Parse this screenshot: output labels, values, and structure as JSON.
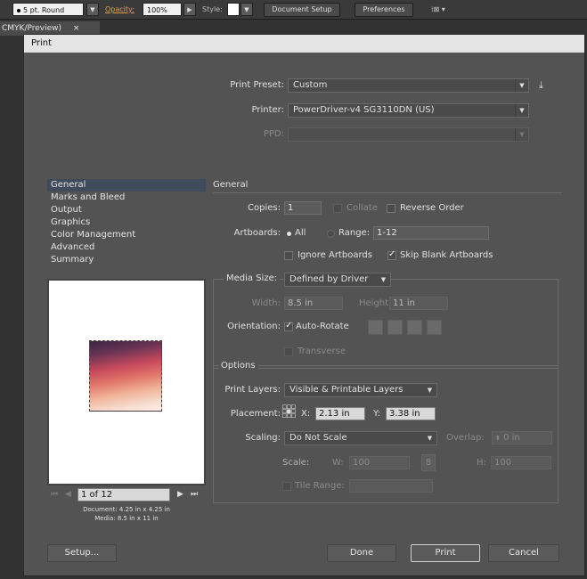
{
  "toolbar": {
    "brush": "5 pt. Round",
    "opacity_label": "Opacity:",
    "opacity_value": "100%",
    "style_label": "Style:",
    "document_setup": "Document Setup",
    "preferences": "Preferences"
  },
  "doc_tab": {
    "title": "CMYK/Preview)",
    "close": "×"
  },
  "dialog": {
    "title": "Print",
    "print_preset_label": "Print Preset:",
    "print_preset_value": "Custom",
    "printer_label": "Printer:",
    "printer_value": "PowerDriver-v4 SG3110DN (US)",
    "ppd_label": "PPD:",
    "categories": [
      "General",
      "Marks and Bleed",
      "Output",
      "Graphics",
      "Color Management",
      "Advanced",
      "Summary"
    ],
    "selected_category": "General",
    "section_title": "General",
    "copies_label": "Copies:",
    "copies_value": "1",
    "collate_label": "Collate",
    "reverse_order_label": "Reverse Order",
    "artboards_label": "Artboards:",
    "all_label": "All",
    "range_label": "Range:",
    "range_value": "1-12",
    "ignore_artboards_label": "Ignore Artboards",
    "skip_blank_label": "Skip Blank Artboards",
    "media_size_label": "Media Size:",
    "media_size_value": "Defined by Driver",
    "width_label": "Width:",
    "width_value": "8.5 in",
    "height_label": "Height:",
    "height_value": "11 in",
    "orientation_label": "Orientation:",
    "auto_rotate_label": "Auto-Rotate",
    "transverse_label": "Transverse",
    "options_title": "Options",
    "print_layers_label": "Print Layers:",
    "print_layers_value": "Visible & Printable Layers",
    "placement_label": "Placement:",
    "x_label": "X:",
    "x_value": "2.13 in",
    "y_label": "Y:",
    "y_value": "3.38 in",
    "scaling_label": "Scaling:",
    "scaling_value": "Do Not Scale",
    "overlap_label": "Overlap:",
    "overlap_value": "0 in",
    "scale_label": "Scale:",
    "w_label": "W:",
    "w_value": "100",
    "h_label": "H:",
    "h_value": "100",
    "tile_range_label": "Tile Range:",
    "page_indicator": "1 of 12",
    "document_info": "Document: 4.25 in x 4.25 in",
    "media_info": "Media: 8.5 in x 11 in",
    "setup_button": "Setup...",
    "done_button": "Done",
    "print_button": "Print",
    "cancel_button": "Cancel"
  }
}
